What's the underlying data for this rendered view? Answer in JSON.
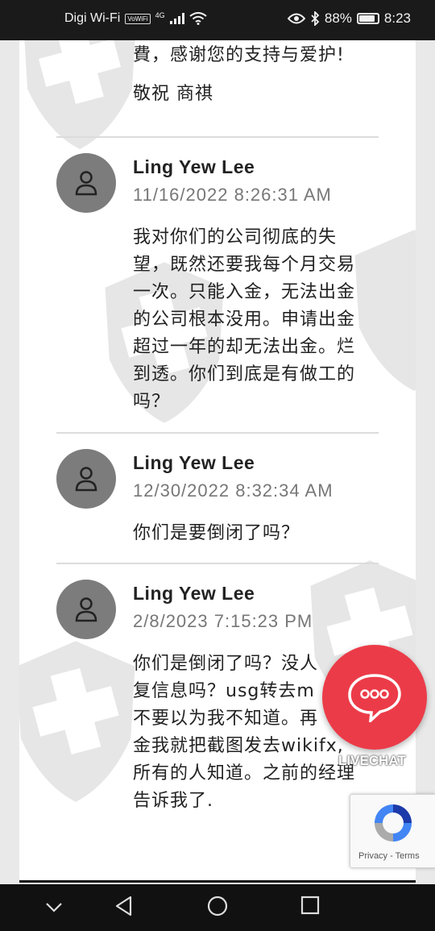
{
  "status_bar": {
    "carrier": "Digi Wi-Fi",
    "vowifi_tag": "VoWiFi",
    "network": "4G",
    "battery": "88%",
    "battery_level": 0.88,
    "time": "8:23"
  },
  "thread": {
    "top_partial": {
      "line1": "費，感谢您的支持与爱护!",
      "line2": "敬祝 商祺"
    },
    "comments": [
      {
        "author": "Ling Yew Lee",
        "date": "11/16/2022 8:26:31 AM",
        "lines": [
          "我对你们的公司彻底的失",
          "望，既然还要我每个月交易",
          "一次。只能入金，无法出金",
          "的公司根本没用。申请出金",
          "超过一年的却无法出金。烂",
          "到透。你们到底是有做工的",
          "吗？"
        ]
      },
      {
        "author": "Ling Yew Lee",
        "date": "12/30/2022 8:32:34 AM",
        "lines": [
          "你们是要倒闭了吗？"
        ]
      },
      {
        "author": "Ling Yew Lee",
        "date": "2/8/2023 7:15:23 PM",
        "lines": [
          "你们是倒闭了吗？没人",
          "复信息吗？usg转去m",
          "不要以为我不知道。再",
          "金我就把截图发去wikifx,",
          "所有的人知道。之前的经理",
          "告诉我了."
        ]
      }
    ]
  },
  "live_chat": {
    "label": "LIVECHAT"
  },
  "recaptcha": {
    "privacy": "Privacy",
    "separator": " - ",
    "terms": "Terms"
  },
  "colors": {
    "live_chat": "#ec3b48",
    "avatar": "#7c7c7c",
    "status_bar": "#1a1a1a",
    "nav_bar": "#111111"
  }
}
